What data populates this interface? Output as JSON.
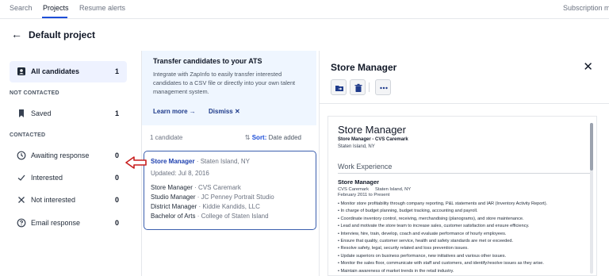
{
  "nav": {
    "tabs": [
      "Search",
      "Projects",
      "Resume alerts"
    ],
    "right_link": "Subscription ma"
  },
  "header": {
    "title": "Default project"
  },
  "sidebar": {
    "all": {
      "label": "All candidates",
      "count": "1"
    },
    "not_contacted_label": "NOT CONTACTED",
    "saved": {
      "label": "Saved",
      "count": "1"
    },
    "contacted_label": "CONTACTED",
    "awaiting": {
      "label": "Awaiting response",
      "count": "0"
    },
    "interested": {
      "label": "Interested",
      "count": "0"
    },
    "not_interested": {
      "label": "Not interested",
      "count": "0"
    },
    "email_response": {
      "label": "Email response",
      "count": "0"
    }
  },
  "ats": {
    "title": "Transfer candidates to your ATS",
    "body": "Integrate with ZapInfo to easily transfer interested candidates to a CSV file or directly into your own talent management system.",
    "learn_more": "Learn more →",
    "dismiss": "Dismiss ✕"
  },
  "list": {
    "count": "1 candidate",
    "sort_label": "Sort:",
    "sort_value": "Date added"
  },
  "candidate": {
    "job_title": "Store Manager",
    "location": "· Staten Island, NY",
    "updated": "Updated: Jul 8, 2016",
    "history": [
      {
        "role": "Store Manager",
        "org": "· CVS Caremark"
      },
      {
        "role": "Studio Manager",
        "org": "· JC Penney Portrait Studio"
      },
      {
        "role": "District Manager",
        "org": "· Kiddie Kandids, LLC"
      },
      {
        "role": "Bachelor of Arts",
        "org": "· College of Staten Island"
      }
    ]
  },
  "panel": {
    "title": "Store Manager",
    "icons": [
      "move-to-folder-icon",
      "trash-icon",
      "more-icon"
    ]
  },
  "resume": {
    "name": "Store Manager",
    "subtitle": "Store Manager - CVS Caremark",
    "location": "Staten Island, NY",
    "section": "Work Experience",
    "job_title": "Store Manager",
    "company": "CVS Caremark     Staten Island, NY",
    "dates": "February 2011 to Present",
    "bullets": [
      "• Monitor store profitability through company reporting, P&L statements and IAR (Inventory Activity Report).",
      "• In charge of budget planning, budget tracking, accounting and payroll.",
      "• Coordinate inventory control, receiving, merchandising (planograms), and store maintenance.",
      "• Lead and motivate the store team to increase sales, customer satisfaction and ensure efficiency.",
      "• Interview, hire, train, develop, coach and evaluate performance of hourly employees.",
      "• Ensure that quality, customer service, health and safety standards are met or exceeded.",
      "• Resolve safety, legal, security related and loss prevention issues.",
      "• Update superiors on business performance, new initiatives and various other issues.",
      "• Monitor the sales floor, communicate with staff and customers, and identify/resolve issues as they arise.",
      "• Maintain awareness of market trends in the retail industry."
    ]
  },
  "colors": {
    "accent": "#1d4ed8",
    "banner_bg": "#eff6ff",
    "active_bg": "#eef2ff",
    "annotation_red": "#c81e1e"
  }
}
